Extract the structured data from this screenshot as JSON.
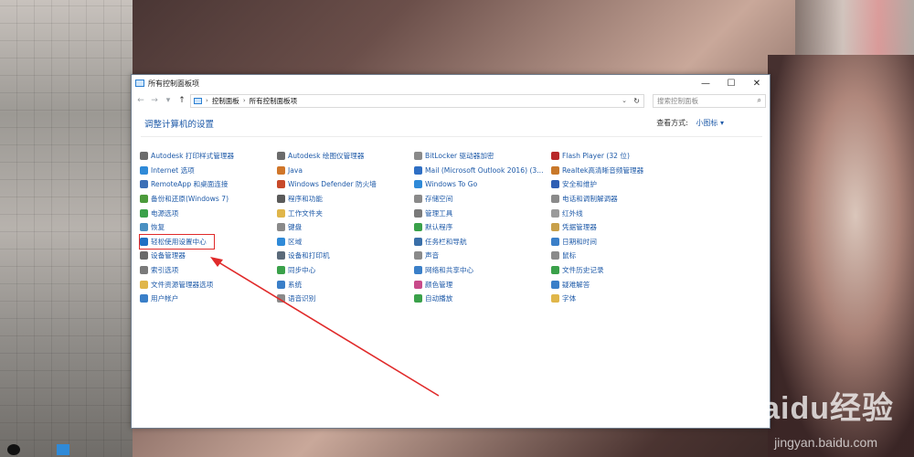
{
  "window": {
    "title": "所有控制面板项",
    "buttons": {
      "minimize": "—",
      "maximize": "☐",
      "close": "✕"
    }
  },
  "nav": {
    "back": "←",
    "forward": "→",
    "recent": "▾",
    "up": "↑",
    "breadcrumb": [
      "控制面板",
      "所有控制面板项"
    ],
    "separator": "›",
    "search_placeholder": "搜索控制面板"
  },
  "header": {
    "title": "调整计算机的设置",
    "view_by_label": "查看方式:",
    "view_by_value": "小图标 ▾"
  },
  "columns": [
    [
      {
        "label": "Autodesk 打印样式管理器",
        "color": "#6b6b6b"
      },
      {
        "label": "Internet 选项",
        "color": "#2f8ad8"
      },
      {
        "label": "RemoteApp 和桌面连接",
        "color": "#3b6fb6"
      },
      {
        "label": "备份和还原(Windows 7)",
        "color": "#4b9a3b"
      },
      {
        "label": "电源选项",
        "color": "#3aa14a"
      },
      {
        "label": "恢复",
        "color": "#4a90c2"
      },
      {
        "label": "轻松使用设置中心",
        "color": "#1f6fc4"
      },
      {
        "label": "设备管理器",
        "color": "#6a6a6a"
      },
      {
        "label": "索引选项",
        "color": "#7a7a7a"
      },
      {
        "label": "文件资源管理器选项",
        "color": "#e0b64a"
      },
      {
        "label": "用户帐户",
        "color": "#3a7fc8"
      }
    ],
    [
      {
        "label": "Autodesk 绘图仪管理器",
        "color": "#6b6b6b"
      },
      {
        "label": "Java",
        "color": "#d0762a"
      },
      {
        "label": "Windows Defender 防火墙",
        "color": "#c84a2a"
      },
      {
        "label": "程序和功能",
        "color": "#5a5a5a"
      },
      {
        "label": "工作文件夹",
        "color": "#e0b64a"
      },
      {
        "label": "键盘",
        "color": "#8a8a8a"
      },
      {
        "label": "区域",
        "color": "#2f8ad8"
      },
      {
        "label": "设备和打印机",
        "color": "#5a6a7a"
      },
      {
        "label": "同步中心",
        "color": "#3aa14a"
      },
      {
        "label": "系统",
        "color": "#3a7fc8"
      },
      {
        "label": "语音识别",
        "color": "#8a8a8a"
      }
    ],
    [
      {
        "label": "BitLocker 驱动器加密",
        "color": "#8a8a8a"
      },
      {
        "label": "Mail (Microsoft Outlook 2016) (3...",
        "color": "#2f6fc4"
      },
      {
        "label": "Windows To Go",
        "color": "#2f8ad8"
      },
      {
        "label": "存储空间",
        "color": "#8a8a8a"
      },
      {
        "label": "管理工具",
        "color": "#7a7a7a"
      },
      {
        "label": "默认程序",
        "color": "#3aa14a"
      },
      {
        "label": "任务栏和导航",
        "color": "#3a6fa8"
      },
      {
        "label": "声音",
        "color": "#8a8a8a"
      },
      {
        "label": "网络和共享中心",
        "color": "#3a7fc8"
      },
      {
        "label": "颜色管理",
        "color": "#c84a8a"
      },
      {
        "label": "自动播放",
        "color": "#3aa14a"
      }
    ],
    [
      {
        "label": "Flash Player (32 位)",
        "color": "#b8282a"
      },
      {
        "label": "Realtek高清晰音频管理器",
        "color": "#c8782a"
      },
      {
        "label": "安全和维护",
        "color": "#2f5fb4"
      },
      {
        "label": "电话和调制解调器",
        "color": "#8a8a8a"
      },
      {
        "label": "红外线",
        "color": "#9a9a9a"
      },
      {
        "label": "凭据管理器",
        "color": "#c8a04a"
      },
      {
        "label": "日期和时间",
        "color": "#3a7fc8"
      },
      {
        "label": "鼠标",
        "color": "#8a8a8a"
      },
      {
        "label": "文件历史记录",
        "color": "#3aa14a"
      },
      {
        "label": "疑难解答",
        "color": "#3a7fc8"
      },
      {
        "label": "字体",
        "color": "#e0b64a"
      }
    ]
  ],
  "watermark": {
    "logo": "Baidu经验",
    "url": "jingyan.baidu.com"
  }
}
